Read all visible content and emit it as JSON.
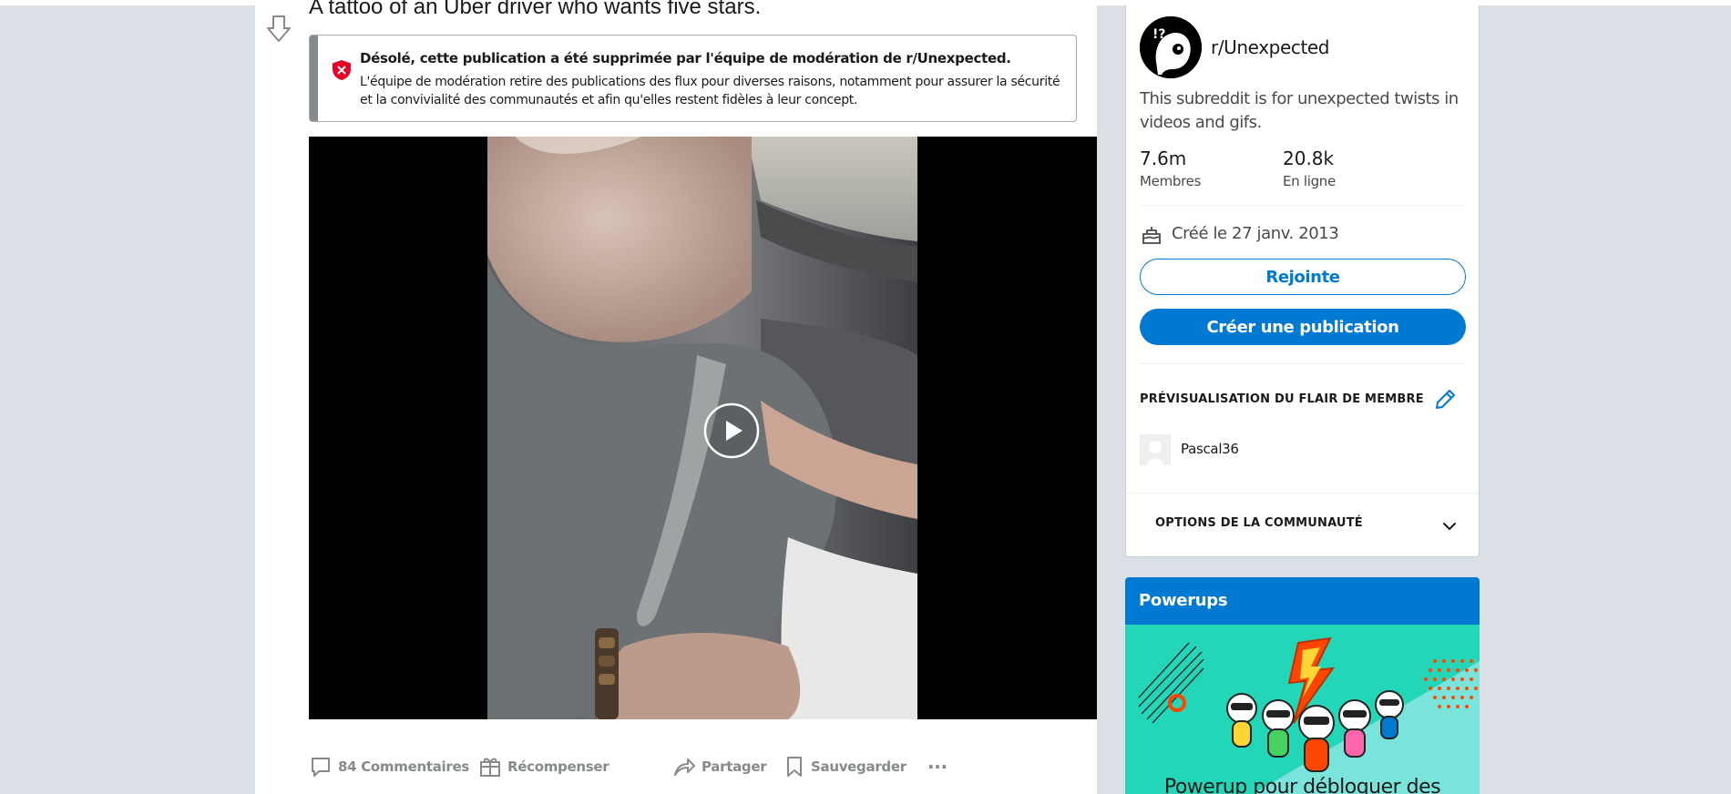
{
  "post": {
    "title": "A tattoo of an Uber driver who wants five stars.",
    "removed_notice": {
      "title": "Désolé, cette publication a été supprimée par l'équipe de modération de r/Unexpected.",
      "text": "L'équipe de modération retire des publications des flux pour diverses raisons, notamment pour assurer la sécurité et la convivialité des communautés et afin qu'elles restent fidèles à leur concept."
    },
    "actions": {
      "comments": "84 Commentaires",
      "award": "Récompenser",
      "share": "Partager",
      "save": "Sauvegarder",
      "more": "···"
    }
  },
  "sidebar": {
    "subreddit": "r/Unexpected",
    "description": "This subreddit is for unexpected twists in videos and gifs.",
    "members_value": "7.6m",
    "members_label": "Membres",
    "online_value": "20.8k",
    "online_label": "En ligne",
    "created": "Créé le 27 janv. 2013",
    "joined_button": "Rejointe",
    "create_post_button": "Créer une publication",
    "flair_heading": "PRÉVISUALISATION DU FLAIR DE MEMBRE",
    "flair_username": "Pascal36",
    "options_heading": "OPTIONS DE LA COMMUNAUTÉ"
  },
  "powerups": {
    "title": "Powerups",
    "text": "Powerup pour débloquer des"
  },
  "colors": {
    "page_bg": "#dae0e6",
    "accent": "#0079d3",
    "removed_icon": "#ea0027",
    "muted": "#878a8c"
  },
  "icons": [
    "downvote-icon",
    "removed-shield-icon",
    "play-icon",
    "comment-icon",
    "award-icon",
    "share-icon",
    "save-icon",
    "more-icon",
    "cake-icon",
    "edit-pencil-icon",
    "chevron-down-icon"
  ]
}
